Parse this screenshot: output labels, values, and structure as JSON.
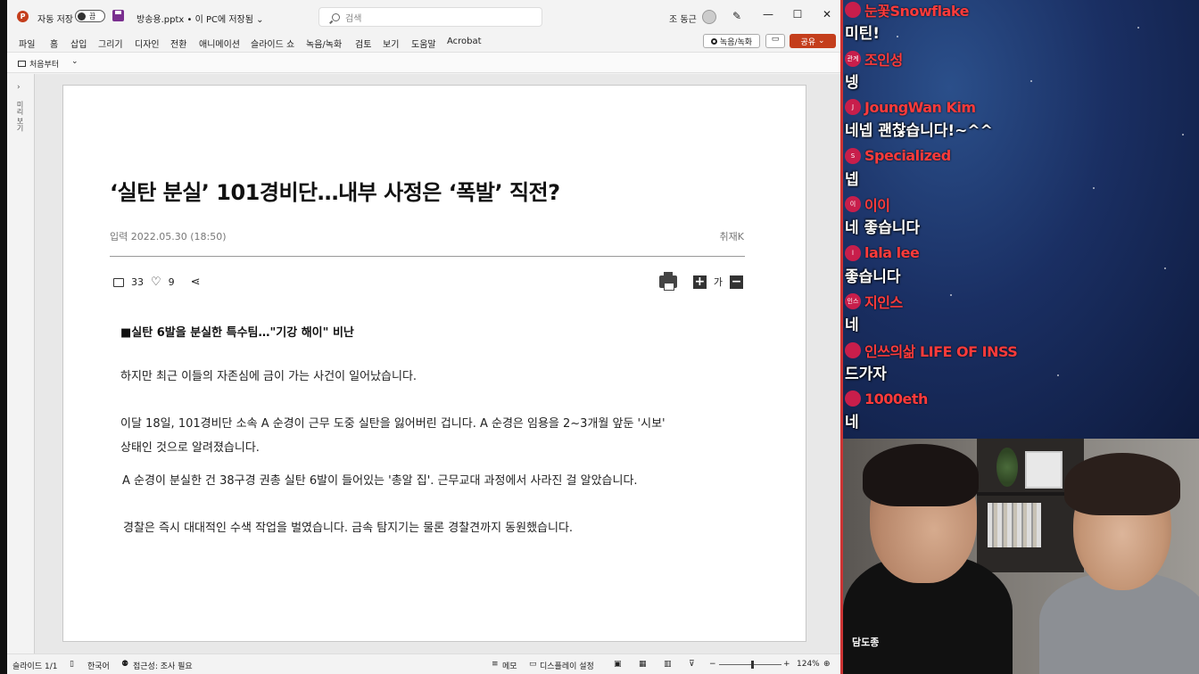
{
  "titlebar": {
    "autosave_label": "자동 저장",
    "autosave_state": "끔",
    "file_name": "방송용.pptx • 이 PC에 저장됨 ⌄",
    "search_placeholder": "검색",
    "user_name": "조 동근",
    "minimize": "—",
    "maximize": "☐",
    "close": "✕"
  },
  "menu": {
    "tabs": [
      "파일",
      "홈",
      "삽입",
      "그리기",
      "디자인",
      "전환",
      "애니메이션",
      "슬라이드 쇼",
      "녹음/녹화",
      "검토",
      "보기",
      "도움말",
      "Acrobat"
    ],
    "record_label": "녹음/녹화",
    "share_label": "공유"
  },
  "ribbon": {
    "from_start": "처음부터",
    "chevron": "⌄"
  },
  "leftpane": {
    "label": "미리 보기"
  },
  "article": {
    "headline": "‘실탄 분실’ 101경비단…내부 사정은 ‘폭발’ 직전?",
    "date": "입력 2022.05.30 (18:50)",
    "byline": "취재K",
    "comments": "33",
    "likes": "9",
    "font_label": "가",
    "subhead": "■실탄 6발을 분실한 특수팀…\"기강 해이\" 비난",
    "paragraphs": [
      "하지만 최근 이들의 자존심에 금이 가는 사건이 일어났습니다.",
      "이달 18일, 101경비단 소속 A 순경이 근무 도중 실탄을 잃어버린 겁니다. A 순경은 임용을 2~3개월 앞둔 '시보'\n상태인 것으로 알려졌습니다.",
      "A 순경이 분실한 건 38구경 권총 실탄 6발이 들어있는 '총알 집'. 근무교대 과정에서 사라진 걸 알았습니다.",
      "경찰은 즉시 대대적인 수색 작업을 벌였습니다. 금속 탐지기는 물론 경찰견까지 동원했습니다."
    ]
  },
  "statusbar": {
    "slide_count": "슬라이드 1/1",
    "language": "한국어",
    "accessibility": "접근성: 조사 필요",
    "notes": "메모",
    "display_settings": "디스플레이 설정",
    "zoom": "124%"
  },
  "chat": [
    {
      "nick": "눈꽃Snowflake",
      "badge": "",
      "text": "미틴!"
    },
    {
      "nick": "조인성",
      "badge": "관계",
      "text": "넹"
    },
    {
      "nick": "JoungWan Kim",
      "badge": "J",
      "text": "네넵 괜찮습니다!~^^"
    },
    {
      "nick": "Specialized",
      "badge": "S",
      "text": "넵"
    },
    {
      "nick": "이이",
      "badge": "이",
      "text": "네 좋습니다"
    },
    {
      "nick": "lala lee",
      "badge": "l",
      "text": "좋습니다"
    },
    {
      "nick": "지인스",
      "badge": "인스",
      "text": "네"
    },
    {
      "nick": "인쓰의삶 LIFE OF INSS",
      "badge": "",
      "text": "드가자"
    },
    {
      "nick": "1000eth",
      "badge": "",
      "text": "네"
    }
  ],
  "webcam": {
    "shirt_text": "담도종"
  }
}
